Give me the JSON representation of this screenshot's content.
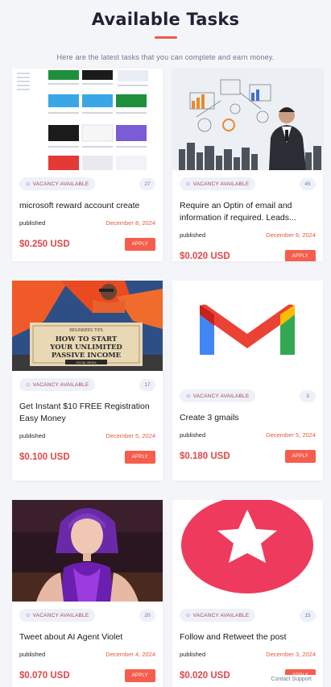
{
  "header": {
    "title": "Available Tasks",
    "subtitle": "Here are the latest tasks that you can complete and earn money."
  },
  "labels": {
    "published": "published",
    "apply": "APPLY"
  },
  "tasks": [
    {
      "badge": "VACANCY AVAILABLE",
      "count": "27",
      "title": "microsoft reward account create",
      "date": "December 8, 2024",
      "price": "$0.250 USD",
      "thumbnail": "app-logos-grid"
    },
    {
      "badge": "VACANCY AVAILABLE",
      "count": "45",
      "title": "Require an Optin of email and information if required. Leads...",
      "date": "December 6, 2024",
      "price": "$0.020 USD",
      "thumbnail": "businessman-city-sketch"
    },
    {
      "badge": "VACANCY AVAILABLE",
      "count": "17",
      "title": "Get Instant $10 FREE Registration Easy Money",
      "date": "December 5, 2024",
      "price": "$0.100 USD",
      "thumbnail": "passive-income-banner",
      "banner_small": "BEGINNERS TIPS",
      "banner_main": "HOW TO START YOUR UNLIMITED PASSIVE INCOME",
      "banner_footer": "SOCIAL MEDIA"
    },
    {
      "badge": "VACANCY AVAILABLE",
      "count": "3",
      "title": "Create 3 gmails",
      "date": "December 5, 2024",
      "price": "$0.180 USD",
      "thumbnail": "gmail-logo"
    },
    {
      "badge": "VACANCY AVAILABLE",
      "count": "20",
      "title": "Tweet about AI Agent Violet",
      "date": "December 4, 2024",
      "price": "$0.070 USD",
      "thumbnail": "ai-agent-portrait"
    },
    {
      "badge": "VACANCY AVAILABLE",
      "count": "15",
      "title": "Follow and Retweet the post",
      "date": "December 3, 2024",
      "price": "$0.020 USD",
      "thumbnail": "red-star-circle"
    }
  ],
  "footer": {
    "note": "Contact Support"
  }
}
